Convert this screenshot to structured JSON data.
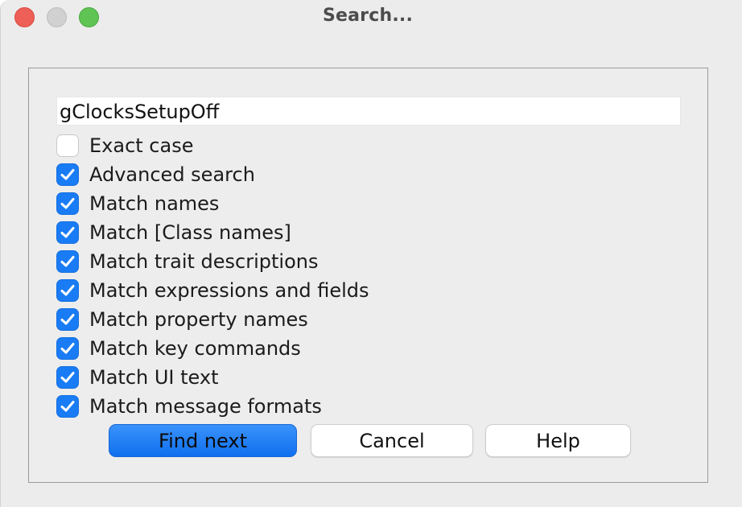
{
  "window": {
    "title": "Search..."
  },
  "search": {
    "value": "gClocksSetupOff"
  },
  "options": [
    {
      "label": "Exact case",
      "checked": false
    },
    {
      "label": "Advanced search",
      "checked": true
    },
    {
      "label": "Match names",
      "checked": true
    },
    {
      "label": "Match [Class names]",
      "checked": true
    },
    {
      "label": "Match trait descriptions",
      "checked": true
    },
    {
      "label": "Match expressions and fields",
      "checked": true
    },
    {
      "label": "Match property names",
      "checked": true
    },
    {
      "label": "Match key commands",
      "checked": true
    },
    {
      "label": "Match UI text",
      "checked": true
    },
    {
      "label": "Match message formats",
      "checked": true
    }
  ],
  "buttons": {
    "find_next": "Find next",
    "cancel": "Cancel",
    "help": "Help"
  },
  "colors": {
    "accent": "#1a7cf5",
    "close": "#ee5f57",
    "minimize": "#d1d1d1",
    "zoom": "#5fc454"
  },
  "icons": {
    "check": "checkmark-icon"
  }
}
